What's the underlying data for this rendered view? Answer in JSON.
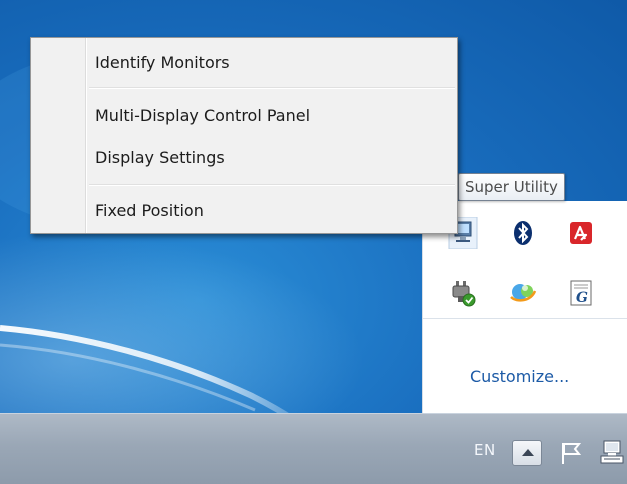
{
  "context_menu": {
    "items": [
      {
        "label": "Identify Monitors"
      },
      {
        "label": "Multi-Display Control Panel"
      },
      {
        "label": "Display Settings"
      },
      {
        "label": "Fixed Position"
      }
    ]
  },
  "tooltip": {
    "text": "Super Utility"
  },
  "tray_overflow": {
    "icons": [
      {
        "name": "super-utility-icon"
      },
      {
        "name": "bluetooth-icon"
      },
      {
        "name": "avira-antivirus-icon"
      },
      {
        "name": "power-plug-icon"
      },
      {
        "name": "messenger-icon"
      },
      {
        "name": "ime-pad-icon"
      }
    ],
    "customize_label": "Customize..."
  },
  "taskbar": {
    "language": "EN",
    "icons": [
      "show-hidden-icons-icon",
      "action-center-flag-icon",
      "network-icon"
    ]
  },
  "colors": {
    "desktop_blue": "#1a6fc0",
    "taskbar": "#9aa7b6",
    "menu_background": "#f1f1f1",
    "link": "#1c5aa6"
  }
}
